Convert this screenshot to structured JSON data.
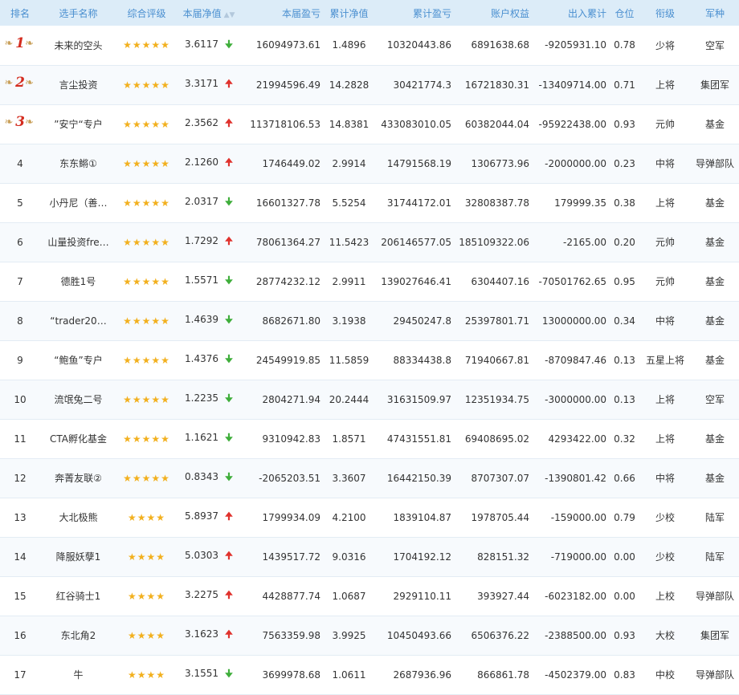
{
  "headers": {
    "rank": "排名",
    "name": "选手名称",
    "rating": "综合评级",
    "nav": "本届净值",
    "profit": "本届盈亏",
    "cum_nav": "累计净值",
    "cum_profit": "累计盈亏",
    "equity": "账户权益",
    "inout": "出入累计",
    "position": "仓位",
    "title": "衔级",
    "army": "军种"
  },
  "colors": {
    "up": "#e0322d",
    "down": "#3fae3b",
    "star": "#f2b01e",
    "header_text": "#4a8fd0"
  },
  "rows": [
    {
      "rank": "1",
      "medal": true,
      "name": "未来的空头",
      "stars": "★★★★★",
      "nav": "3.6117",
      "trend": "down",
      "profit": "16094973.61",
      "cum_nav": "1.4896",
      "cum_profit": "10320443.86",
      "equity": "6891638.68",
      "inout": "-9205931.10",
      "position": "0.78",
      "title": "少将",
      "army": "空军"
    },
    {
      "rank": "2",
      "medal": true,
      "name": "言尘投资",
      "stars": "★★★★★",
      "nav": "3.3171",
      "trend": "up",
      "profit": "21994596.49",
      "cum_nav": "14.2828",
      "cum_profit": "30421774.3",
      "equity": "16721830.31",
      "inout": "-13409714.00",
      "position": "0.71",
      "title": "上将",
      "army": "集团军"
    },
    {
      "rank": "3",
      "medal": true,
      "name": "”安宁“专户",
      "stars": "★★★★★",
      "nav": "2.3562",
      "trend": "up",
      "profit": "113718106.53",
      "cum_nav": "14.8381",
      "cum_profit": "433083010.05",
      "equity": "60382044.04",
      "inout": "-95922438.00",
      "position": "0.93",
      "title": "元帅",
      "army": "基金"
    },
    {
      "rank": "4",
      "medal": false,
      "name": "东东鳉①",
      "stars": "★★★★★",
      "nav": "2.1260",
      "trend": "up",
      "profit": "1746449.02",
      "cum_nav": "2.9914",
      "cum_profit": "14791568.19",
      "equity": "1306773.96",
      "inout": "-2000000.00",
      "position": "0.23",
      "title": "中将",
      "army": "导弹部队"
    },
    {
      "rank": "5",
      "medal": false,
      "name": "小丹尼（善…",
      "stars": "★★★★★",
      "nav": "2.0317",
      "trend": "down",
      "profit": "16601327.78",
      "cum_nav": "5.5254",
      "cum_profit": "31744172.01",
      "equity": "32808387.78",
      "inout": "179999.35",
      "position": "0.38",
      "title": "上将",
      "army": "基金"
    },
    {
      "rank": "6",
      "medal": false,
      "name": "山量投资fre…",
      "stars": "★★★★★",
      "nav": "1.7292",
      "trend": "up",
      "profit": "78061364.27",
      "cum_nav": "11.5423",
      "cum_profit": "206146577.05",
      "equity": "185109322.06",
      "inout": "-2165.00",
      "position": "0.20",
      "title": "元帅",
      "army": "基金"
    },
    {
      "rank": "7",
      "medal": false,
      "name": "德胜1号",
      "stars": "★★★★★",
      "nav": "1.5571",
      "trend": "down",
      "profit": "28774232.12",
      "cum_nav": "2.9911",
      "cum_profit": "139027646.41",
      "equity": "6304407.16",
      "inout": "-70501762.65",
      "position": "0.95",
      "title": "元帅",
      "army": "基金"
    },
    {
      "rank": "8",
      "medal": false,
      "name": "“trader20…",
      "stars": "★★★★★",
      "nav": "1.4639",
      "trend": "down",
      "profit": "8682671.80",
      "cum_nav": "3.1938",
      "cum_profit": "29450247.8",
      "equity": "25397801.71",
      "inout": "13000000.00",
      "position": "0.34",
      "title": "中将",
      "army": "基金"
    },
    {
      "rank": "9",
      "medal": false,
      "name": "“鲍鱼”专户",
      "stars": "★★★★★",
      "nav": "1.4376",
      "trend": "down",
      "profit": "24549919.85",
      "cum_nav": "11.5859",
      "cum_profit": "88334438.8",
      "equity": "71940667.81",
      "inout": "-8709847.46",
      "position": "0.13",
      "title": "五星上将",
      "army": "基金"
    },
    {
      "rank": "10",
      "medal": false,
      "name": "流氓兔二号",
      "stars": "★★★★★",
      "nav": "1.2235",
      "trend": "down",
      "profit": "2804271.94",
      "cum_nav": "20.2444",
      "cum_profit": "31631509.97",
      "equity": "12351934.75",
      "inout": "-3000000.00",
      "position": "0.13",
      "title": "上将",
      "army": "空军"
    },
    {
      "rank": "11",
      "medal": false,
      "name": "CTA孵化基金",
      "stars": "★★★★★",
      "nav": "1.1621",
      "trend": "down",
      "profit": "9310942.83",
      "cum_nav": "1.8571",
      "cum_profit": "47431551.81",
      "equity": "69408695.02",
      "inout": "4293422.00",
      "position": "0.32",
      "title": "上将",
      "army": "基金"
    },
    {
      "rank": "12",
      "medal": false,
      "name": "奔菁友联②",
      "stars": "★★★★★",
      "nav": "0.8343",
      "trend": "down",
      "profit": "-2065203.51",
      "cum_nav": "3.3607",
      "cum_profit": "16442150.39",
      "equity": "8707307.07",
      "inout": "-1390801.42",
      "position": "0.66",
      "title": "中将",
      "army": "基金"
    },
    {
      "rank": "13",
      "medal": false,
      "name": "大北极熊",
      "stars": "★★★★",
      "nav": "5.8937",
      "trend": "up",
      "profit": "1799934.09",
      "cum_nav": "4.2100",
      "cum_profit": "1839104.87",
      "equity": "1978705.44",
      "inout": "-159000.00",
      "position": "0.79",
      "title": "少校",
      "army": "陆军"
    },
    {
      "rank": "14",
      "medal": false,
      "name": "降服妖孽1",
      "stars": "★★★★",
      "nav": "5.0303",
      "trend": "up",
      "profit": "1439517.72",
      "cum_nav": "9.0316",
      "cum_profit": "1704192.12",
      "equity": "828151.32",
      "inout": "-719000.00",
      "position": "0.00",
      "title": "少校",
      "army": "陆军"
    },
    {
      "rank": "15",
      "medal": false,
      "name": "红谷骑士1",
      "stars": "★★★★",
      "nav": "3.2275",
      "trend": "up",
      "profit": "4428877.74",
      "cum_nav": "1.0687",
      "cum_profit": "2929110.11",
      "equity": "393927.44",
      "inout": "-6023182.00",
      "position": "0.00",
      "title": "上校",
      "army": "导弹部队"
    },
    {
      "rank": "16",
      "medal": false,
      "name": "东北角2",
      "stars": "★★★★",
      "nav": "3.1623",
      "trend": "up",
      "profit": "7563359.98",
      "cum_nav": "3.9925",
      "cum_profit": "10450493.66",
      "equity": "6506376.22",
      "inout": "-2388500.00",
      "position": "0.93",
      "title": "大校",
      "army": "集团军"
    },
    {
      "rank": "17",
      "medal": false,
      "name": "牛",
      "stars": "★★★★",
      "nav": "3.1551",
      "trend": "down",
      "profit": "3699978.68",
      "cum_nav": "1.0611",
      "cum_profit": "2687936.96",
      "equity": "866861.78",
      "inout": "-4502379.00",
      "position": "0.83",
      "title": "中校",
      "army": "导弹部队"
    }
  ]
}
